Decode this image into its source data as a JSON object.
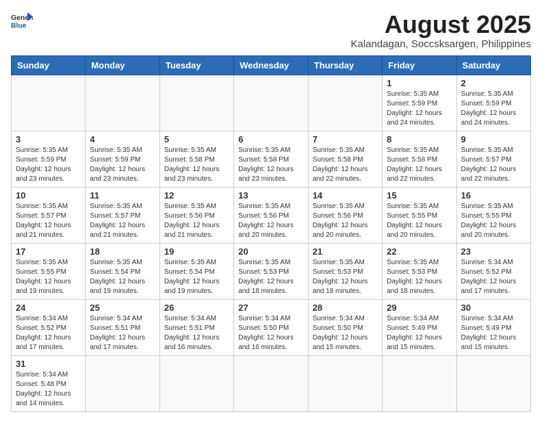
{
  "header": {
    "logo_general": "General",
    "logo_blue": "Blue",
    "month_year": "August 2025",
    "location": "Kalandagan, Soccsksargen, Philippines"
  },
  "days_of_week": [
    "Sunday",
    "Monday",
    "Tuesday",
    "Wednesday",
    "Thursday",
    "Friday",
    "Saturday"
  ],
  "weeks": [
    [
      {
        "day": "",
        "info": ""
      },
      {
        "day": "",
        "info": ""
      },
      {
        "day": "",
        "info": ""
      },
      {
        "day": "",
        "info": ""
      },
      {
        "day": "",
        "info": ""
      },
      {
        "day": "1",
        "info": "Sunrise: 5:35 AM\nSunset: 5:59 PM\nDaylight: 12 hours\nand 24 minutes."
      },
      {
        "day": "2",
        "info": "Sunrise: 5:35 AM\nSunset: 5:59 PM\nDaylight: 12 hours\nand 24 minutes."
      }
    ],
    [
      {
        "day": "3",
        "info": "Sunrise: 5:35 AM\nSunset: 5:59 PM\nDaylight: 12 hours\nand 23 minutes."
      },
      {
        "day": "4",
        "info": "Sunrise: 5:35 AM\nSunset: 5:59 PM\nDaylight: 12 hours\nand 23 minutes."
      },
      {
        "day": "5",
        "info": "Sunrise: 5:35 AM\nSunset: 5:58 PM\nDaylight: 12 hours\nand 23 minutes."
      },
      {
        "day": "6",
        "info": "Sunrise: 5:35 AM\nSunset: 5:58 PM\nDaylight: 12 hours\nand 23 minutes."
      },
      {
        "day": "7",
        "info": "Sunrise: 5:35 AM\nSunset: 5:58 PM\nDaylight: 12 hours\nand 22 minutes."
      },
      {
        "day": "8",
        "info": "Sunrise: 5:35 AM\nSunset: 5:58 PM\nDaylight: 12 hours\nand 22 minutes."
      },
      {
        "day": "9",
        "info": "Sunrise: 5:35 AM\nSunset: 5:57 PM\nDaylight: 12 hours\nand 22 minutes."
      }
    ],
    [
      {
        "day": "10",
        "info": "Sunrise: 5:35 AM\nSunset: 5:57 PM\nDaylight: 12 hours\nand 21 minutes."
      },
      {
        "day": "11",
        "info": "Sunrise: 5:35 AM\nSunset: 5:57 PM\nDaylight: 12 hours\nand 21 minutes."
      },
      {
        "day": "12",
        "info": "Sunrise: 5:35 AM\nSunset: 5:56 PM\nDaylight: 12 hours\nand 21 minutes."
      },
      {
        "day": "13",
        "info": "Sunrise: 5:35 AM\nSunset: 5:56 PM\nDaylight: 12 hours\nand 20 minutes."
      },
      {
        "day": "14",
        "info": "Sunrise: 5:35 AM\nSunset: 5:56 PM\nDaylight: 12 hours\nand 20 minutes."
      },
      {
        "day": "15",
        "info": "Sunrise: 5:35 AM\nSunset: 5:55 PM\nDaylight: 12 hours\nand 20 minutes."
      },
      {
        "day": "16",
        "info": "Sunrise: 5:35 AM\nSunset: 5:55 PM\nDaylight: 12 hours\nand 20 minutes."
      }
    ],
    [
      {
        "day": "17",
        "info": "Sunrise: 5:35 AM\nSunset: 5:55 PM\nDaylight: 12 hours\nand 19 minutes."
      },
      {
        "day": "18",
        "info": "Sunrise: 5:35 AM\nSunset: 5:54 PM\nDaylight: 12 hours\nand 19 minutes."
      },
      {
        "day": "19",
        "info": "Sunrise: 5:35 AM\nSunset: 5:54 PM\nDaylight: 12 hours\nand 19 minutes."
      },
      {
        "day": "20",
        "info": "Sunrise: 5:35 AM\nSunset: 5:53 PM\nDaylight: 12 hours\nand 18 minutes."
      },
      {
        "day": "21",
        "info": "Sunrise: 5:35 AM\nSunset: 5:53 PM\nDaylight: 12 hours\nand 18 minutes."
      },
      {
        "day": "22",
        "info": "Sunrise: 5:35 AM\nSunset: 5:53 PM\nDaylight: 12 hours\nand 18 minutes."
      },
      {
        "day": "23",
        "info": "Sunrise: 5:34 AM\nSunset: 5:52 PM\nDaylight: 12 hours\nand 17 minutes."
      }
    ],
    [
      {
        "day": "24",
        "info": "Sunrise: 5:34 AM\nSunset: 5:52 PM\nDaylight: 12 hours\nand 17 minutes."
      },
      {
        "day": "25",
        "info": "Sunrise: 5:34 AM\nSunset: 5:51 PM\nDaylight: 12 hours\nand 17 minutes."
      },
      {
        "day": "26",
        "info": "Sunrise: 5:34 AM\nSunset: 5:51 PM\nDaylight: 12 hours\nand 16 minutes."
      },
      {
        "day": "27",
        "info": "Sunrise: 5:34 AM\nSunset: 5:50 PM\nDaylight: 12 hours\nand 16 minutes."
      },
      {
        "day": "28",
        "info": "Sunrise: 5:34 AM\nSunset: 5:50 PM\nDaylight: 12 hours\nand 15 minutes."
      },
      {
        "day": "29",
        "info": "Sunrise: 5:34 AM\nSunset: 5:49 PM\nDaylight: 12 hours\nand 15 minutes."
      },
      {
        "day": "30",
        "info": "Sunrise: 5:34 AM\nSunset: 5:49 PM\nDaylight: 12 hours\nand 15 minutes."
      }
    ],
    [
      {
        "day": "31",
        "info": "Sunrise: 5:34 AM\nSunset: 5:48 PM\nDaylight: 12 hours\nand 14 minutes."
      },
      {
        "day": "",
        "info": ""
      },
      {
        "day": "",
        "info": ""
      },
      {
        "day": "",
        "info": ""
      },
      {
        "day": "",
        "info": ""
      },
      {
        "day": "",
        "info": ""
      },
      {
        "day": "",
        "info": ""
      }
    ]
  ]
}
